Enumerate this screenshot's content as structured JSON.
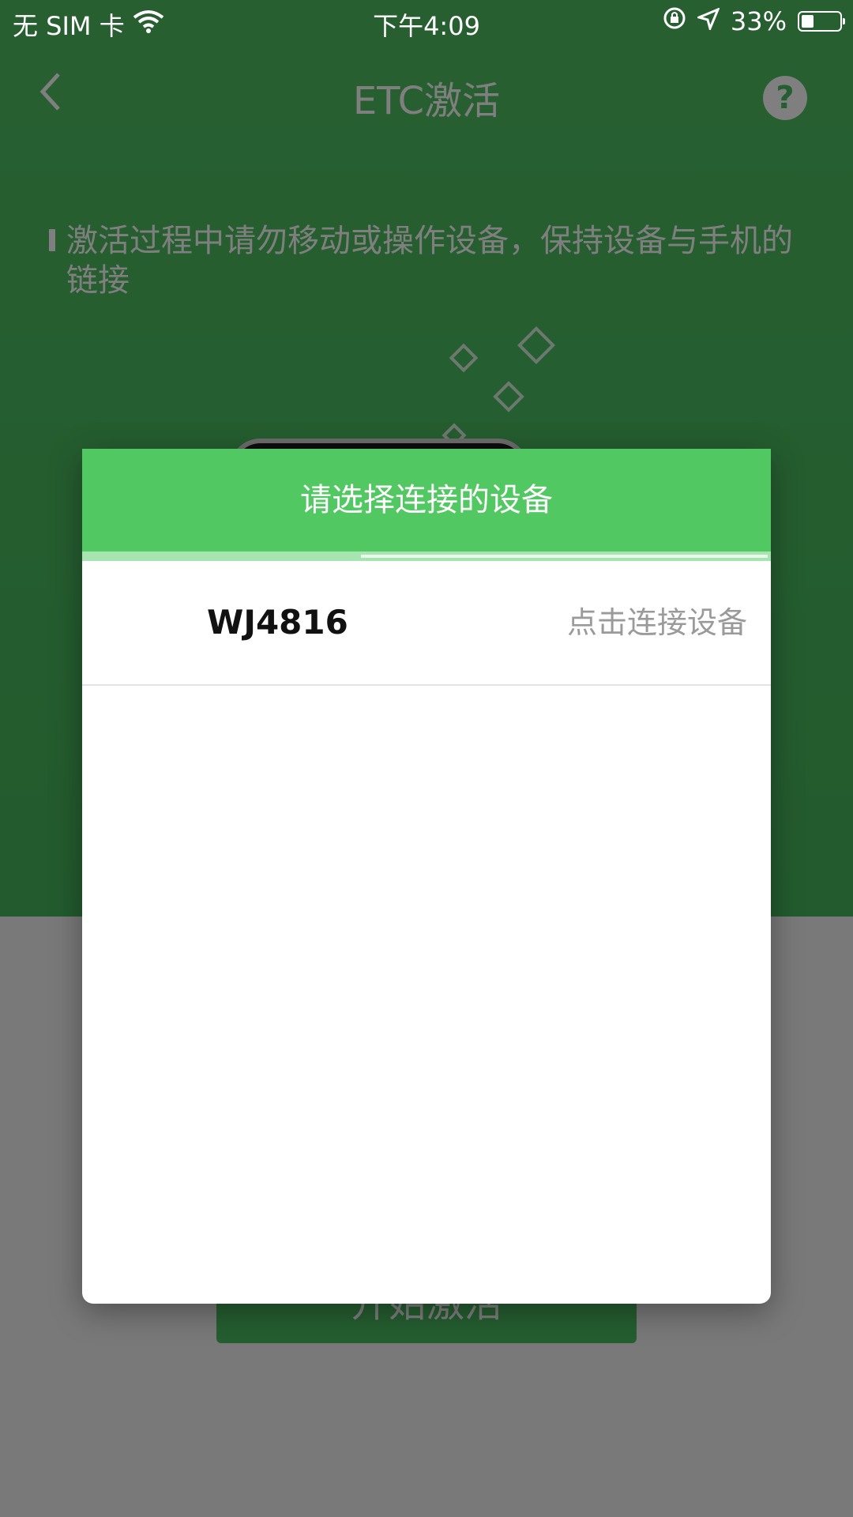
{
  "status_bar": {
    "carrier": "无 SIM 卡",
    "time": "下午4:09",
    "battery_percent": "33%",
    "icons": [
      "wifi-icon",
      "orientation-lock-icon",
      "location-arrow-icon",
      "battery-icon"
    ],
    "battery_level": 0.33
  },
  "nav": {
    "title": "ETC激活",
    "back_icon": "chevron-left-icon",
    "help_label": "?"
  },
  "tip": {
    "text": "激活过程中请勿移动或操作设备，保持设备与手机的链接"
  },
  "start_button": {
    "label": "开始激活"
  },
  "dialog": {
    "title": "请选择连接的设备",
    "progress": 0.4,
    "devices": [
      {
        "name": "WJ4816",
        "action": "点击连接设备"
      }
    ]
  },
  "colors": {
    "brand_green": "#52c862",
    "background_green": "#4bbc60",
    "secondary_text": "#9a9a9a"
  }
}
